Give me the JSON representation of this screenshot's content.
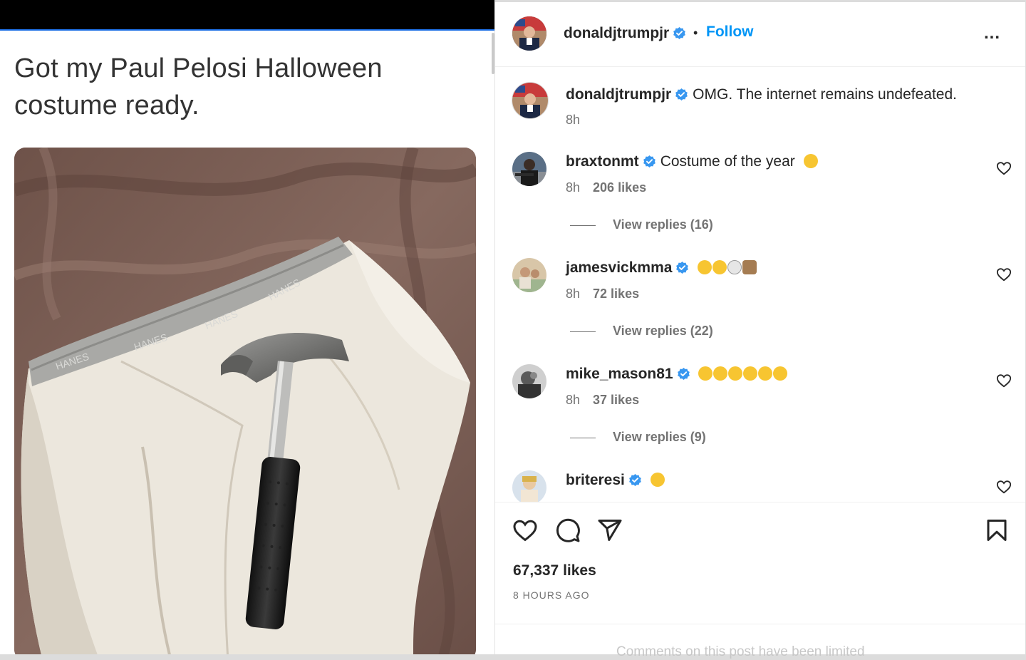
{
  "tweet": {
    "text": "Got my Paul Pelosi Halloween costume ready.",
    "image_brand_text": "HANES"
  },
  "post": {
    "author": "donaldjtrumpjr",
    "separator": "•",
    "follow_label": "Follow",
    "more_label": "...",
    "caption": {
      "username": "donaldjtrumpjr",
      "text": "OMG. The internet remains undefeated.",
      "time": "8h"
    },
    "comments": [
      {
        "username": "braxtonmt",
        "text": "Costume of the year",
        "emoji": [
          "rofl"
        ],
        "time": "8h",
        "likes": "206 likes",
        "replies": "View replies (16)"
      },
      {
        "username": "jamesvickmma",
        "text": "",
        "emoji": [
          "joy",
          "joy",
          "skull",
          "goat"
        ],
        "time": "8h",
        "likes": "72 likes",
        "replies": "View replies (22)"
      },
      {
        "username": "mike_mason81",
        "text": "",
        "emoji": [
          "joy",
          "joy",
          "joy",
          "joy",
          "joy",
          "joy"
        ],
        "time": "8h",
        "likes": "37 likes",
        "replies": "View replies (9)"
      },
      {
        "username": "briteresi",
        "text": "",
        "emoji": [
          "joy"
        ]
      }
    ],
    "total_likes": "67,337 likes",
    "time_ago": "8 HOURS AGO",
    "limited_notice": "Comments on this post have been limited"
  },
  "colors": {
    "accent": "#0095f6",
    "verified": "#3897f0",
    "text": "#262626",
    "muted": "#737373"
  },
  "icons": [
    "verified-badge-icon",
    "more-icon",
    "heart-icon",
    "comment-icon",
    "share-icon",
    "bookmark-icon"
  ]
}
